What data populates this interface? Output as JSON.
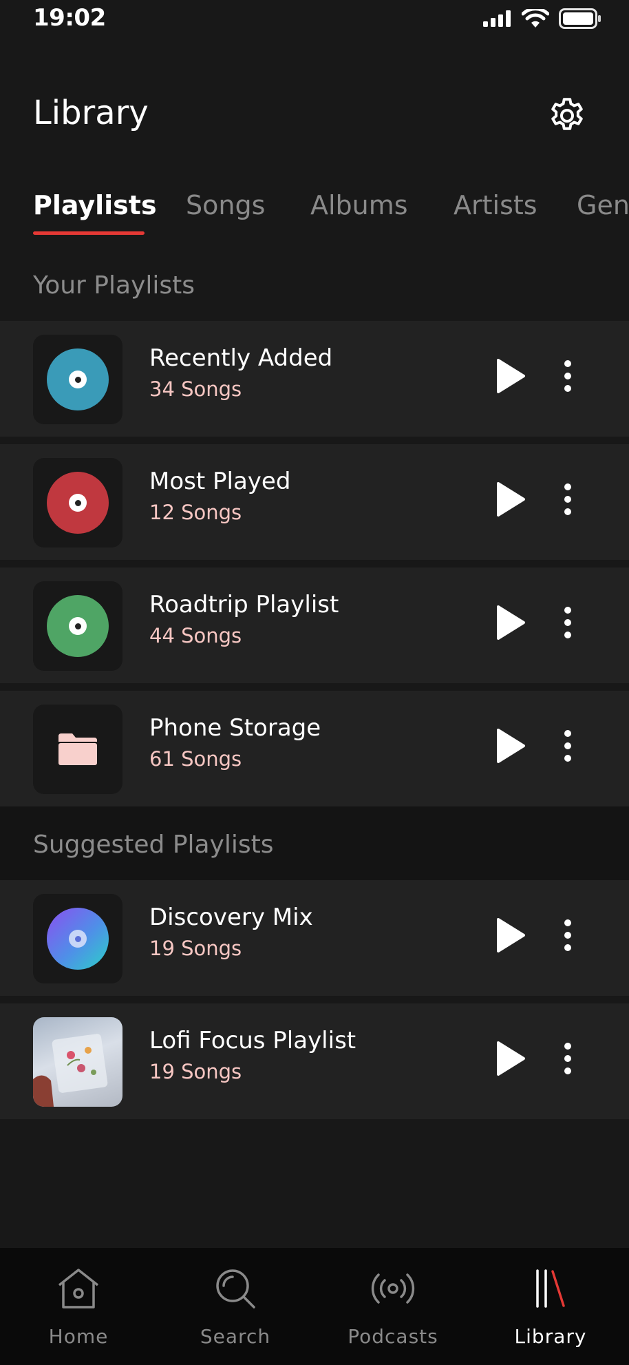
{
  "status": {
    "time": "19:02"
  },
  "header": {
    "title": "Library"
  },
  "tabs": [
    "Playlists",
    "Songs",
    "Albums",
    "Artists",
    "Gen"
  ],
  "sections": {
    "your": "Your Playlists",
    "suggested": "Suggested Playlists"
  },
  "your_playlists": [
    {
      "title": "Recently Added",
      "count": "34 Songs",
      "icon": "disc-icon",
      "color": "#3a9bb8"
    },
    {
      "title": "Most Played",
      "count": "12 Songs",
      "icon": "disc-icon",
      "color": "#c0383f"
    },
    {
      "title": "Roadtrip Playlist",
      "count": "44 Songs",
      "icon": "disc-icon",
      "color": "#4fa565"
    },
    {
      "title": "Phone Storage",
      "count": "61 Songs",
      "icon": "folder-icon",
      "color": "#f8d0cc"
    }
  ],
  "suggested_playlists": [
    {
      "title": "Discovery Mix",
      "count": "19 Songs",
      "icon": "gradient-disc-icon"
    },
    {
      "title": "Lofi Focus Playlist",
      "count": "19 Songs",
      "icon": "album-art-image"
    }
  ],
  "nav": [
    "Home",
    "Search",
    "Podcasts",
    "Library"
  ],
  "colors": {
    "accent": "#e53935",
    "subtitle": "#f6c6c2",
    "background": "#181818",
    "row": "#222222"
  }
}
